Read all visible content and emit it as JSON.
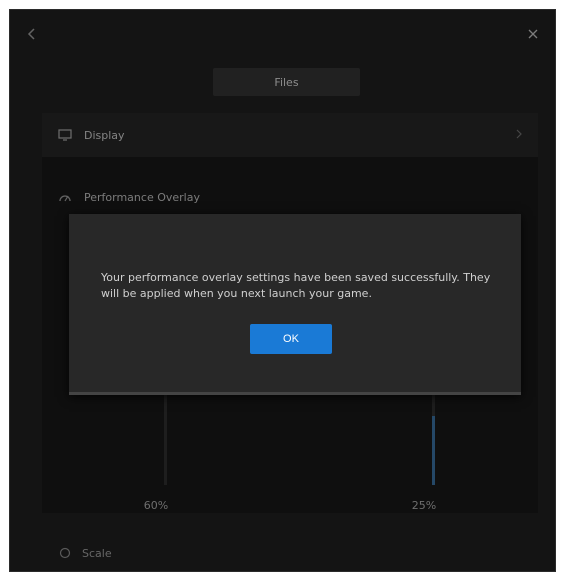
{
  "header": {
    "tab_label": "Files"
  },
  "main": {
    "display_row": {
      "label": "Display",
      "icon": "monitor-icon"
    },
    "performance": {
      "label": "Performance Overlay",
      "icon": "gauge-icon"
    },
    "sliders": [
      {
        "value_label": "60%",
        "level": 0.0
      },
      {
        "value_label": "25%",
        "level": 0.75
      }
    ],
    "bottom_row": {
      "label": "Scale",
      "icon": "circle-icon"
    }
  },
  "dialog": {
    "message": "Your performance overlay settings have been saved successfully. They will be applied when you next launch your game.",
    "ok_label": "OK"
  },
  "colors": {
    "window_bg": "#1f1f1f",
    "accent": "#1a7ad6"
  }
}
